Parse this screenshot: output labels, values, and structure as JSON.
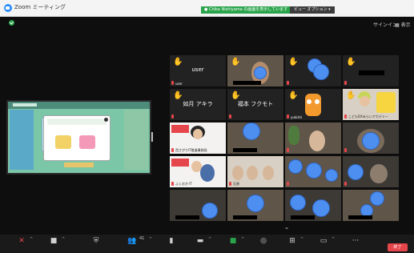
{
  "window": {
    "title": "Zoom ミーティング"
  },
  "banner": {
    "text": "● Chika Nishiyama の画面を表示しています",
    "view_options": "ビュー オプション ▾"
  },
  "top_right": {
    "signin": "サインイン",
    "view": "▦ 表示"
  },
  "share": {
    "presenter": "Chika Nishiyama"
  },
  "gallery": {
    "tiles": [
      {
        "name": "user",
        "tag": "user"
      },
      {
        "name": "",
        "tag": ""
      },
      {
        "name": "",
        "tag": ""
      },
      {
        "name": "",
        "tag": ""
      },
      {
        "name": "如月 アキラ",
        "tag": ""
      },
      {
        "name": "福本 フクモト",
        "tag": ""
      },
      {
        "name": "",
        "tag": "yukishi"
      },
      {
        "name": "",
        "tag": "こどもDXみらいアカデミー"
      },
      {
        "name": "",
        "tag": "西さがりIT推進事務局"
      },
      {
        "name": "",
        "tag": ""
      },
      {
        "name": "",
        "tag": ""
      },
      {
        "name": "",
        "tag": ""
      },
      {
        "name": "",
        "tag": "ふくおか IT"
      },
      {
        "name": "",
        "tag": "石原"
      },
      {
        "name": "",
        "tag": ""
      },
      {
        "name": "",
        "tag": ""
      },
      {
        "name": "",
        "tag": ""
      },
      {
        "name": "",
        "tag": ""
      },
      {
        "name": "",
        "tag": ""
      },
      {
        "name": "",
        "tag": ""
      }
    ]
  },
  "toolbar": {
    "participants_count": "41",
    "end": "終了"
  },
  "icons": {
    "mute": "microphone-muted-icon",
    "video": "video-camera-icon",
    "security": "shield-icon",
    "participants": "participants-icon",
    "polls": "polls-icon",
    "chat": "chat-icon",
    "share": "share-screen-icon",
    "record": "record-icon",
    "breakout": "breakout-rooms-icon",
    "reactions": "reactions-icon",
    "more": "more-icon"
  },
  "colors": {
    "accent_green": "#2aa44b",
    "end_red": "#e5464b",
    "zoom_blue": "#2d8cff",
    "hand_yellow": "#f2c12e"
  }
}
